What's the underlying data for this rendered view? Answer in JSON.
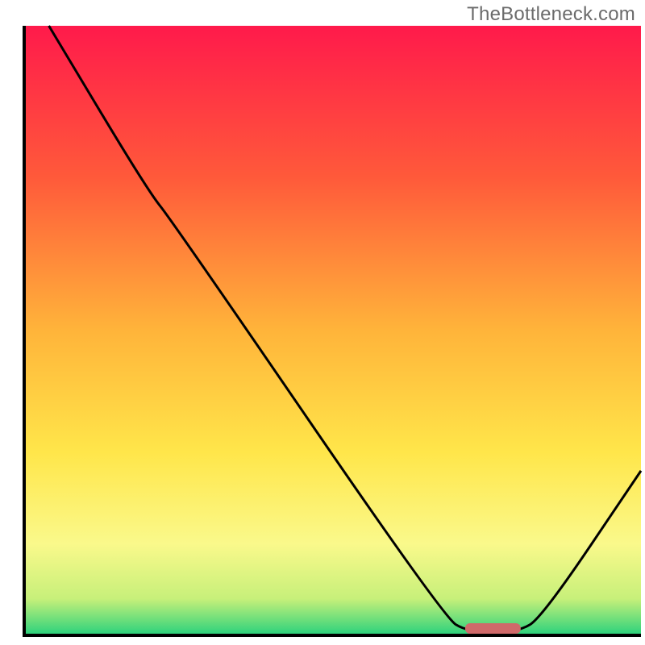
{
  "watermark": "TheBottleneck.com",
  "chart_data": {
    "type": "line",
    "title": "",
    "xlabel": "",
    "ylabel": "",
    "xlim": [
      0,
      100
    ],
    "ylim": [
      0,
      100
    ],
    "background_gradient": {
      "stops": [
        {
          "offset": 0,
          "color": "#ff1a4b"
        },
        {
          "offset": 25,
          "color": "#ff5a3a"
        },
        {
          "offset": 50,
          "color": "#ffb43a"
        },
        {
          "offset": 70,
          "color": "#ffe64a"
        },
        {
          "offset": 85,
          "color": "#faf98b"
        },
        {
          "offset": 94,
          "color": "#c7f07a"
        },
        {
          "offset": 100,
          "color": "#28d17c"
        }
      ]
    },
    "series": [
      {
        "name": "curve",
        "type": "line",
        "color": "#000000",
        "points": [
          {
            "x": 4,
            "y": 100
          },
          {
            "x": 20,
            "y": 73
          },
          {
            "x": 24,
            "y": 68
          },
          {
            "x": 68,
            "y": 3
          },
          {
            "x": 72,
            "y": 0.5
          },
          {
            "x": 80,
            "y": 0.5
          },
          {
            "x": 84,
            "y": 3
          },
          {
            "x": 100,
            "y": 27
          }
        ]
      }
    ],
    "marker": {
      "x": 76,
      "width": 9,
      "color": "#d06a6a"
    }
  }
}
